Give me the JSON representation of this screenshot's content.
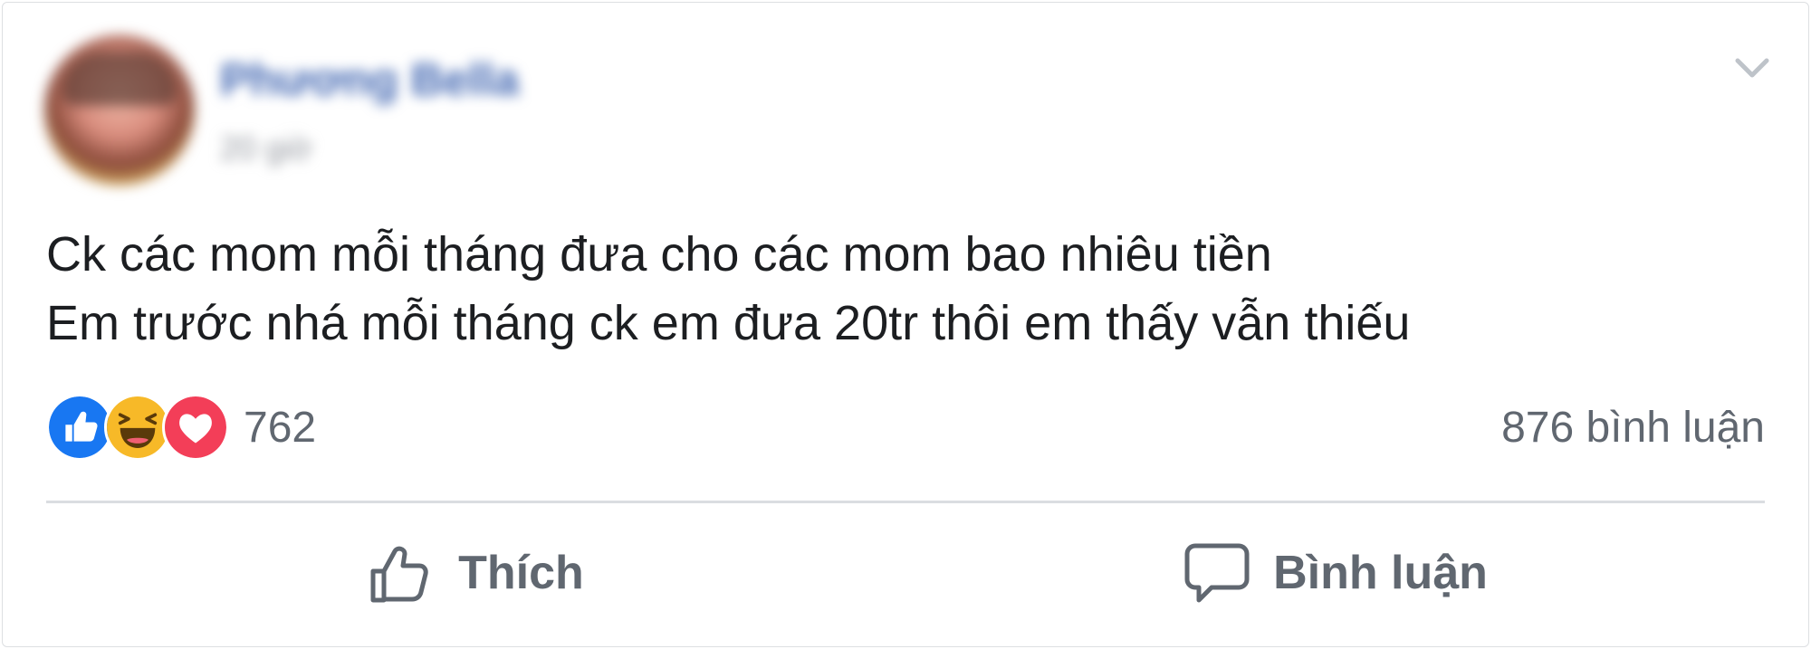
{
  "post": {
    "author_name": "Phương Bella",
    "timestamp": "20 giờ",
    "body_lines": [
      "Ck các mom mỗi tháng đưa cho các mom bao nhiêu tiền",
      "Em trước nhá mỗi tháng ck em đưa 20tr thôi em thấy vẫn thiếu"
    ],
    "reactions": {
      "icons": [
        "like-reaction-icon",
        "haha-reaction-icon",
        "love-reaction-icon"
      ],
      "count": "762"
    },
    "comment_count": "876 bình luận",
    "actions": {
      "like_label": "Thích",
      "comment_label": "Bình luận"
    }
  },
  "colors": {
    "like_blue": "#1877f2",
    "haha_yellow": "#f7b928",
    "love_red": "#f33e58",
    "text_secondary": "#606770",
    "text_primary": "#1c1e21"
  }
}
